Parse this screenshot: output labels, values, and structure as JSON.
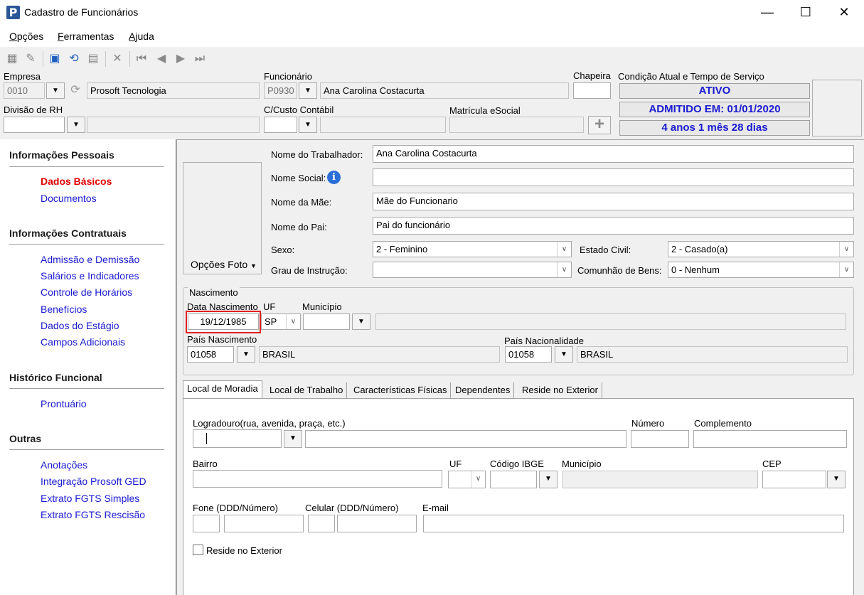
{
  "window": {
    "title": "Cadastro de Funcionários",
    "app_icon_glyph": "P",
    "minimize_glyph": "—",
    "maximize_glyph": "☐",
    "close_glyph": "✕"
  },
  "menu": {
    "items": [
      {
        "accel": "O",
        "rest": "pções"
      },
      {
        "accel": "F",
        "rest": "erramentas"
      },
      {
        "accel": "A",
        "rest": "juda"
      }
    ]
  },
  "toolbar": {
    "icons": [
      "new-icon",
      "edit-icon",
      "save-icon",
      "undo-icon",
      "print-icon",
      "delete-icon",
      "first-icon",
      "prev-icon",
      "next-icon",
      "last-icon"
    ]
  },
  "header": {
    "empresa_label": "Empresa",
    "empresa_code": "0010",
    "empresa_name": "Prosoft Tecnologia",
    "funcionario_label": "Funcionário",
    "funcionario_code": "P0930",
    "funcionario_name": "Ana Carolina Costacurta",
    "chapeira_label": "Chapeira",
    "chapeira_value": "",
    "condicao_label": "Condição Atual e Tempo de Serviço",
    "status_ativo": "ATIVO",
    "status_admitido": "ADMITIDO EM: 01/01/2020",
    "status_tempo": "4 anos 1 mês 28 dias",
    "divisao_label": "Divisão de RH",
    "divisao_value": "",
    "divisao_name": "",
    "ccusto_label": "C/Custo Contábil",
    "ccusto_value": "",
    "ccusto_name": "",
    "matricula_label": "Matrícula eSocial",
    "matricula_value": "",
    "add_glyph": "+"
  },
  "sidebar": {
    "sections": [
      {
        "title": "Informações Pessoais",
        "links": [
          "Dados Básicos",
          "Documentos"
        ]
      },
      {
        "title": "Informações Contratuais",
        "links": [
          "Admissão e Demissão",
          "Salários e Indicadores",
          "Controle de Horários",
          "Benefícios",
          "Dados do Estágio",
          "Campos Adicionais"
        ]
      },
      {
        "title": "Histórico Funcional",
        "links": [
          "Prontuário"
        ]
      },
      {
        "title": "Outras",
        "links": [
          "Anotações",
          "Integração Prosoft GED",
          "Extrato FGTS Simples",
          "Extrato FGTS Rescisão"
        ]
      }
    ],
    "active_link": "Dados Básicos"
  },
  "dados_basicos": {
    "photo_options_label": "Opções Foto",
    "nome_trabalhador_label": "Nome do Trabalhador:",
    "nome_trabalhador": "Ana Carolina Costacurta",
    "nome_social_label": "Nome Social:",
    "nome_social": "",
    "nome_mae_label": "Nome da Mãe:",
    "nome_mae": "Mãe do Funcionario",
    "nome_pai_label": "Nome do Pai:",
    "nome_pai": "Pai do funcionário",
    "sexo_label": "Sexo:",
    "sexo": "2 - Feminino",
    "estado_civil_label": "Estado Civil:",
    "estado_civil": "2 - Casado(a)",
    "grau_instrucao_label": "Grau de Instrução:",
    "grau_instrucao": "",
    "comunhao_label": "Comunhão de Bens:",
    "comunhao": "0 - Nenhum"
  },
  "nascimento": {
    "legend": "Nascimento",
    "data_label": "Data Nascimento",
    "data": "19/12/1985",
    "uf_label": "UF",
    "uf": "SP",
    "municipio_label": "Município",
    "municipio_code": "",
    "municipio_name": "",
    "pais_nasc_label": "País Nascimento",
    "pais_nasc_code": "01058",
    "pais_nasc_name": "BRASIL",
    "pais_nac_label": "País Nacionalidade",
    "pais_nac_code": "01058",
    "pais_nac_name": "BRASIL"
  },
  "tabs": {
    "items": [
      "Local de Moradia",
      "Local de Trabalho",
      "Características Físicas",
      "Dependentes",
      "Reside no Exterior"
    ],
    "active": "Local de Moradia"
  },
  "moradia": {
    "logradouro_label": "Logradouro(rua, avenida, praça, etc.)",
    "logradouro_tipo": "",
    "logradouro": "",
    "numero_label": "Número",
    "numero": "",
    "complemento_label": "Complemento",
    "complemento": "",
    "bairro_label": "Bairro",
    "bairro": "",
    "uf_label": "UF",
    "uf": "",
    "ibge_label": "Código IBGE",
    "ibge": "",
    "municipio_label": "Município",
    "municipio": "",
    "cep_label": "CEP",
    "cep": "",
    "fone_label": "Fone (DDD/Número)",
    "celular_label": "Celular (DDD/Número)",
    "email_label": "E-mail",
    "email": "",
    "reside_exterior_label": "Reside no Exterior",
    "reside_exterior_checked": false
  },
  "colors": {
    "link": "#1a1ad0",
    "active_link": "#e00000",
    "status_text": "#1a1ad0",
    "highlight_box": "#e02020"
  }
}
